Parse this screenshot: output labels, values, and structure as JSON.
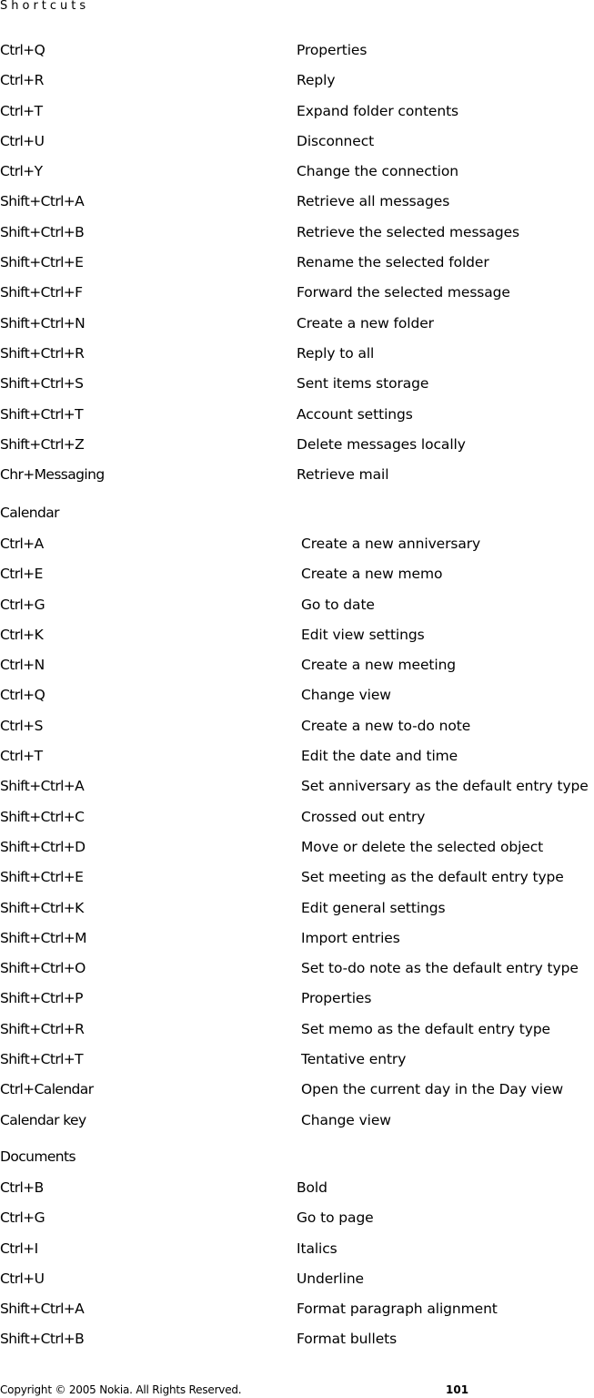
{
  "header": {
    "title": "Shortcuts"
  },
  "messaging": {
    "rows": [
      {
        "key": "Ctrl+Q",
        "desc": "Properties"
      },
      {
        "key": "Ctrl+R",
        "desc": "Reply"
      },
      {
        "key": "Ctrl+T",
        "desc": "Expand folder contents"
      },
      {
        "key": "Ctrl+U",
        "desc": "Disconnect"
      },
      {
        "key": "Ctrl+Y",
        "desc": "Change the connection"
      },
      {
        "key": "Shift+Ctrl+A",
        "desc": "Retrieve all messages"
      },
      {
        "key": "Shift+Ctrl+B",
        "desc": "Retrieve the selected messages"
      },
      {
        "key": "Shift+Ctrl+E",
        "desc": "Rename the selected folder"
      },
      {
        "key": "Shift+Ctrl+F",
        "desc": "Forward the selected message"
      },
      {
        "key": "Shift+Ctrl+N",
        "desc": "Create a new folder"
      },
      {
        "key": "Shift+Ctrl+R",
        "desc": "Reply to all"
      },
      {
        "key": "Shift+Ctrl+S",
        "desc": "Sent items storage"
      },
      {
        "key": "Shift+Ctrl+T",
        "desc": "Account settings"
      },
      {
        "key": "Shift+Ctrl+Z",
        "desc": "Delete messages locally"
      },
      {
        "key": "Chr+Messaging",
        "desc": "Retrieve mail"
      }
    ]
  },
  "calendar": {
    "title": "Calendar",
    "rows": [
      {
        "key": "Ctrl+A",
        "desc": "Create a new anniversary"
      },
      {
        "key": "Ctrl+E",
        "desc": "Create a new memo"
      },
      {
        "key": "Ctrl+G",
        "desc": "Go to date"
      },
      {
        "key": "Ctrl+K",
        "desc": "Edit view settings"
      },
      {
        "key": "Ctrl+N",
        "desc": "Create a new meeting"
      },
      {
        "key": "Ctrl+Q",
        "desc": "Change view"
      },
      {
        "key": "Ctrl+S",
        "desc": "Create a new to-do note"
      },
      {
        "key": "Ctrl+T",
        "desc": "Edit the date and time"
      },
      {
        "key": "Shift+Ctrl+A",
        "desc": "Set anniversary as the default entry type"
      },
      {
        "key": "Shift+Ctrl+C",
        "desc": "Crossed out entry"
      },
      {
        "key": "Shift+Ctrl+D",
        "desc": "Move or delete the selected object"
      },
      {
        "key": "Shift+Ctrl+E",
        "desc": "Set meeting as the default entry type"
      },
      {
        "key": "Shift+Ctrl+K",
        "desc": "Edit general settings"
      },
      {
        "key": "Shift+Ctrl+M",
        "desc": "Import entries"
      },
      {
        "key": "Shift+Ctrl+O",
        "desc": "Set to-do note as the default entry type"
      },
      {
        "key": "Shift+Ctrl+P",
        "desc": "Properties"
      },
      {
        "key": "Shift+Ctrl+R",
        "desc": "Set memo as the default entry type"
      },
      {
        "key": "Shift+Ctrl+T",
        "desc": "Tentative entry"
      },
      {
        "key": "Ctrl+Calendar",
        "desc": "Open the current day in the Day view"
      },
      {
        "key": "Calendar key",
        "desc": "Change view"
      }
    ]
  },
  "documents": {
    "title": "Documents",
    "rows": [
      {
        "key": "Ctrl+B",
        "desc": "Bold"
      },
      {
        "key": "Ctrl+G",
        "desc": "Go to page"
      },
      {
        "key": "Ctrl+I",
        "desc": "Italics"
      },
      {
        "key": "Ctrl+U",
        "desc": "Underline"
      },
      {
        "key": "Shift+Ctrl+A",
        "desc": "Format paragraph alignment"
      },
      {
        "key": "Shift+Ctrl+B",
        "desc": "Format bullets"
      }
    ]
  },
  "footer": {
    "copyright": "Copyright © 2005 Nokia. All Rights Reserved.",
    "page_number": "101"
  }
}
